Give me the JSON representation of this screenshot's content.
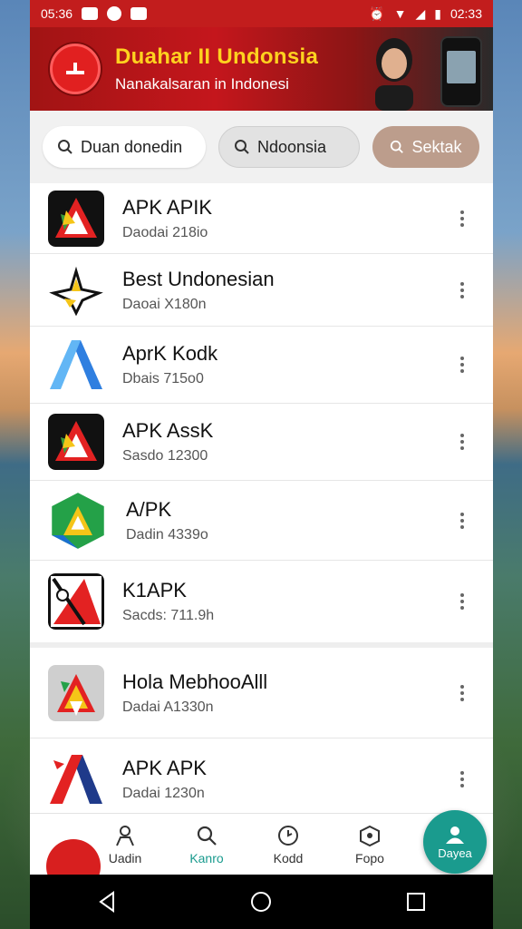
{
  "status_bar": {
    "time_left": "05:36",
    "time_right": "02:33"
  },
  "banner": {
    "title": "Duahar II Undonsia",
    "subtitle": "Nanakalsaran in Indonesi"
  },
  "search": {
    "chip1_label": "Duan donedin",
    "chip2_label": "Ndoonsia",
    "chip3_label": "Sektak"
  },
  "apps": [
    {
      "title": "APK APIK",
      "subtitle": "Daodai 218io",
      "icon": "apk-red-a-icon"
    },
    {
      "title": "Best Undonesian",
      "subtitle": "Daoai X180n",
      "icon": "star-a-icon"
    },
    {
      "title": "AprK Kodk",
      "subtitle": "Dbais 715o0",
      "icon": "blue-a-icon"
    },
    {
      "title": "APK AssK",
      "subtitle": "Sasdo 12300",
      "icon": "apk-red-a-icon"
    },
    {
      "title": "A/PK",
      "subtitle": "Dadin 4339o",
      "icon": "green-triangle-icon"
    },
    {
      "title": "K1APK",
      "subtitle": "Sacds: 711.9h",
      "icon": "red-black-a-icon"
    },
    {
      "title": "Hola MebhooAlll",
      "subtitle": "Dadai A1330n",
      "icon": "grey-a-icon"
    },
    {
      "title": "APK APK",
      "subtitle": "Dadai 1230n",
      "icon": "red-blue-a-icon"
    }
  ],
  "bottom_nav": {
    "items": [
      {
        "label": "Uadin",
        "icon": "person-icon"
      },
      {
        "label": "Kanro",
        "icon": "search-icon"
      },
      {
        "label": "Kodd",
        "icon": "clock-icon"
      },
      {
        "label": "Fopo",
        "icon": "box-icon"
      }
    ],
    "fab_label": "Dayea"
  },
  "colors": {
    "status_red": "#c21d1d",
    "accent_teal": "#1a9b8e",
    "banner_yellow": "#ffd21f",
    "chip_tan": "#bc9d8c"
  }
}
